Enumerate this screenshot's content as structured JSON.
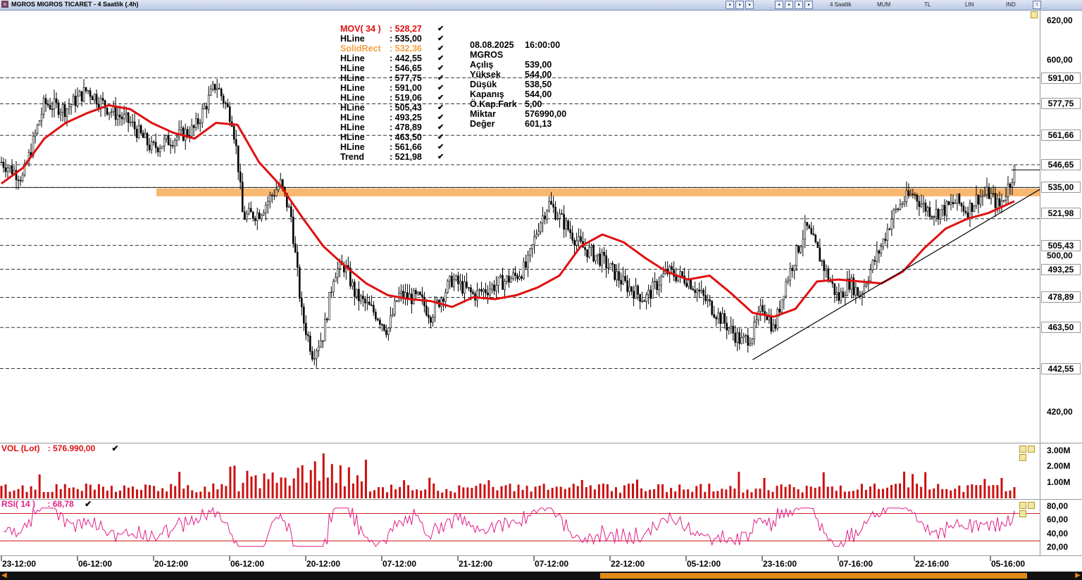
{
  "window": {
    "title": "MGROS MIGROS TICARET - 4 Saatlik (.4h)",
    "toolbar": {
      "period": "4 Saatlik",
      "style": "MUM",
      "currency": "TL",
      "scale": "LIN",
      "indicators": "IND"
    }
  },
  "legend": [
    {
      "name": "MOV( 34 )",
      "value": ": 528,27",
      "color": "#e01010"
    },
    {
      "name": "HLine",
      "value": ": 535,00",
      "color": "#000000"
    },
    {
      "name": "SolidRect",
      "value": ": 532,36",
      "color": "#f5a040"
    },
    {
      "name": "HLine",
      "value": ": 442,55",
      "color": "#000000"
    },
    {
      "name": "HLine",
      "value": ": 546,65",
      "color": "#000000"
    },
    {
      "name": "HLine",
      "value": ": 577,75",
      "color": "#000000"
    },
    {
      "name": "HLine",
      "value": ": 591,00",
      "color": "#000000"
    },
    {
      "name": "HLine",
      "value": ": 519,06",
      "color": "#000000"
    },
    {
      "name": "HLine",
      "value": ": 505,43",
      "color": "#000000"
    },
    {
      "name": "HLine",
      "value": ": 493,25",
      "color": "#000000"
    },
    {
      "name": "HLine",
      "value": ": 478,89",
      "color": "#000000"
    },
    {
      "name": "HLine",
      "value": ": 463,50",
      "color": "#000000"
    },
    {
      "name": "HLine",
      "value": ": 561,66",
      "color": "#000000"
    },
    {
      "name": "Trend",
      "value": ": 521,98",
      "color": "#000000"
    }
  ],
  "info_box": {
    "date": "08.08.2025",
    "time": "16:00:00",
    "symbol": "MGROS",
    "rows": [
      {
        "k": "Açılış",
        "v": "539,00"
      },
      {
        "k": "Yüksek",
        "v": "544,00"
      },
      {
        "k": "Düşük",
        "v": "538,50"
      },
      {
        "k": "Kapanış",
        "v": "544,00"
      },
      {
        "k": "Ö.Kap.Fark",
        "v": "5,00"
      },
      {
        "k": "Miktar",
        "v": "576990,00"
      },
      {
        "k": "Değer",
        "v": "601,13"
      }
    ]
  },
  "volume_pane": {
    "label": "VOL (Lot)",
    "value": ": 576.990,00",
    "axis_ticks": [
      "3.00M",
      "2.00M",
      "1.00M"
    ]
  },
  "rsi_pane": {
    "label": "RSI( 14 )",
    "value": ": 68,78",
    "axis_ticks": [
      "80,00",
      "60,00",
      "40,00",
      "20,00"
    ]
  },
  "colors": {
    "ma": "#e01010",
    "band": "#f5a040",
    "vol": "#cc1010",
    "rsi": "#e0208a",
    "rsi_band": "#cc2020"
  },
  "chart_data": {
    "type": "candlestick",
    "price_ylim": [
      405,
      625
    ],
    "price_axis_ticks": [
      620,
      600,
      500,
      420
    ],
    "price_axis_tick_labels": [
      "620,00",
      "600,00",
      "500,00",
      "420,00"
    ],
    "hlines": [
      591.0,
      577.75,
      561.66,
      546.65,
      535.0,
      519.06,
      505.43,
      493.25,
      478.89,
      463.5,
      442.55
    ],
    "price_tags": [
      "591,00",
      "577,75",
      "561,66",
      "546,65",
      "535,00",
      "521,98",
      "505,43",
      "493,25",
      "478,89",
      "463,50",
      "442,55"
    ],
    "price_tag_values": [
      591.0,
      577.75,
      561.66,
      546.65,
      535.0,
      521.98,
      505.43,
      493.25,
      478.89,
      463.5,
      442.55
    ],
    "solid_rect": {
      "low": 530.5,
      "high": 534.5
    },
    "trend": {
      "from": {
        "bar": 0.7,
        "price": 447
      },
      "to": {
        "bar": 1.0,
        "price": 528
      }
    },
    "x_labels": [
      "23-12:00",
      "06-12:00",
      "20-12:00",
      "06-12:00",
      "20-12:00",
      "07-12:00",
      "21-12:00",
      "07-12:00",
      "22-12:00",
      "05-12:00",
      "23-16:00",
      "07-16:00",
      "22-16:00",
      "05-16:00"
    ],
    "ma_path": [
      [
        0,
        537
      ],
      [
        0.02,
        545
      ],
      [
        0.04,
        560
      ],
      [
        0.06,
        568
      ],
      [
        0.08,
        573
      ],
      [
        0.1,
        577
      ],
      [
        0.12,
        575
      ],
      [
        0.14,
        568
      ],
      [
        0.16,
        563
      ],
      [
        0.18,
        560
      ],
      [
        0.2,
        568
      ],
      [
        0.22,
        567
      ],
      [
        0.24,
        548
      ],
      [
        0.26,
        536
      ],
      [
        0.28,
        520
      ],
      [
        0.3,
        505
      ],
      [
        0.32,
        495
      ],
      [
        0.34,
        486
      ],
      [
        0.36,
        480
      ],
      [
        0.38,
        478
      ],
      [
        0.4,
        477
      ],
      [
        0.42,
        474
      ],
      [
        0.44,
        479
      ],
      [
        0.46,
        478
      ],
      [
        0.48,
        480
      ],
      [
        0.5,
        484
      ],
      [
        0.52,
        490
      ],
      [
        0.54,
        505
      ],
      [
        0.56,
        511
      ],
      [
        0.58,
        507
      ],
      [
        0.6,
        499
      ],
      [
        0.62,
        492
      ],
      [
        0.64,
        488
      ],
      [
        0.66,
        490
      ],
      [
        0.68,
        481
      ],
      [
        0.7,
        471
      ],
      [
        0.72,
        469
      ],
      [
        0.74,
        473
      ],
      [
        0.76,
        487
      ],
      [
        0.78,
        488
      ],
      [
        0.8,
        487
      ],
      [
        0.82,
        486
      ],
      [
        0.84,
        492
      ],
      [
        0.86,
        504
      ],
      [
        0.88,
        514
      ],
      [
        0.9,
        519
      ],
      [
        0.92,
        522
      ],
      [
        0.94,
        527
      ],
      [
        0.944,
        528
      ]
    ],
    "candles_seed": [
      [
        0,
        548
      ],
      [
        0.02,
        540
      ],
      [
        0.04,
        578
      ],
      [
        0.06,
        575
      ],
      [
        0.08,
        585
      ],
      [
        0.1,
        575
      ],
      [
        0.12,
        568
      ],
      [
        0.14,
        555
      ],
      [
        0.16,
        560
      ],
      [
        0.18,
        565
      ],
      [
        0.2,
        588
      ],
      [
        0.215,
        570
      ],
      [
        0.22,
        550
      ],
      [
        0.225,
        520
      ],
      [
        0.24,
        522
      ],
      [
        0.26,
        537
      ],
      [
        0.27,
        520
      ],
      [
        0.28,
        470
      ],
      [
        0.29,
        450
      ],
      [
        0.3,
        460
      ],
      [
        0.31,
        492
      ],
      [
        0.32,
        495
      ],
      [
        0.33,
        480
      ],
      [
        0.35,
        470
      ],
      [
        0.36,
        462
      ],
      [
        0.37,
        480
      ],
      [
        0.39,
        478
      ],
      [
        0.4,
        470
      ],
      [
        0.42,
        488
      ],
      [
        0.44,
        480
      ],
      [
        0.46,
        485
      ],
      [
        0.48,
        490
      ],
      [
        0.49,
        495
      ],
      [
        0.5,
        515
      ],
      [
        0.51,
        527
      ],
      [
        0.52,
        520
      ],
      [
        0.54,
        505
      ],
      [
        0.56,
        498
      ],
      [
        0.58,
        486
      ],
      [
        0.6,
        478
      ],
      [
        0.62,
        492
      ],
      [
        0.64,
        488
      ],
      [
        0.66,
        475
      ],
      [
        0.68,
        462
      ],
      [
        0.69,
        456
      ],
      [
        0.7,
        460
      ],
      [
        0.71,
        475
      ],
      [
        0.72,
        462
      ],
      [
        0.73,
        485
      ],
      [
        0.74,
        500
      ],
      [
        0.75,
        515
      ],
      [
        0.76,
        503
      ],
      [
        0.77,
        490
      ],
      [
        0.78,
        478
      ],
      [
        0.79,
        487
      ],
      [
        0.8,
        480
      ],
      [
        0.81,
        493
      ],
      [
        0.82,
        505
      ],
      [
        0.83,
        520
      ],
      [
        0.84,
        528
      ],
      [
        0.85,
        532
      ],
      [
        0.86,
        525
      ],
      [
        0.87,
        522
      ],
      [
        0.88,
        524
      ],
      [
        0.89,
        528
      ],
      [
        0.9,
        523
      ],
      [
        0.91,
        530
      ],
      [
        0.92,
        532
      ],
      [
        0.93,
        525
      ],
      [
        0.94,
        538
      ],
      [
        0.944,
        544
      ]
    ],
    "volume": {
      "ylim": [
        0,
        3300000
      ],
      "ticks": [
        3000000,
        2000000,
        1000000
      ]
    },
    "rsi": {
      "ylim": [
        10,
        90
      ],
      "ticks": [
        80,
        60,
        40,
        20
      ],
      "bands": [
        70,
        30
      ],
      "last": 68.78
    }
  }
}
